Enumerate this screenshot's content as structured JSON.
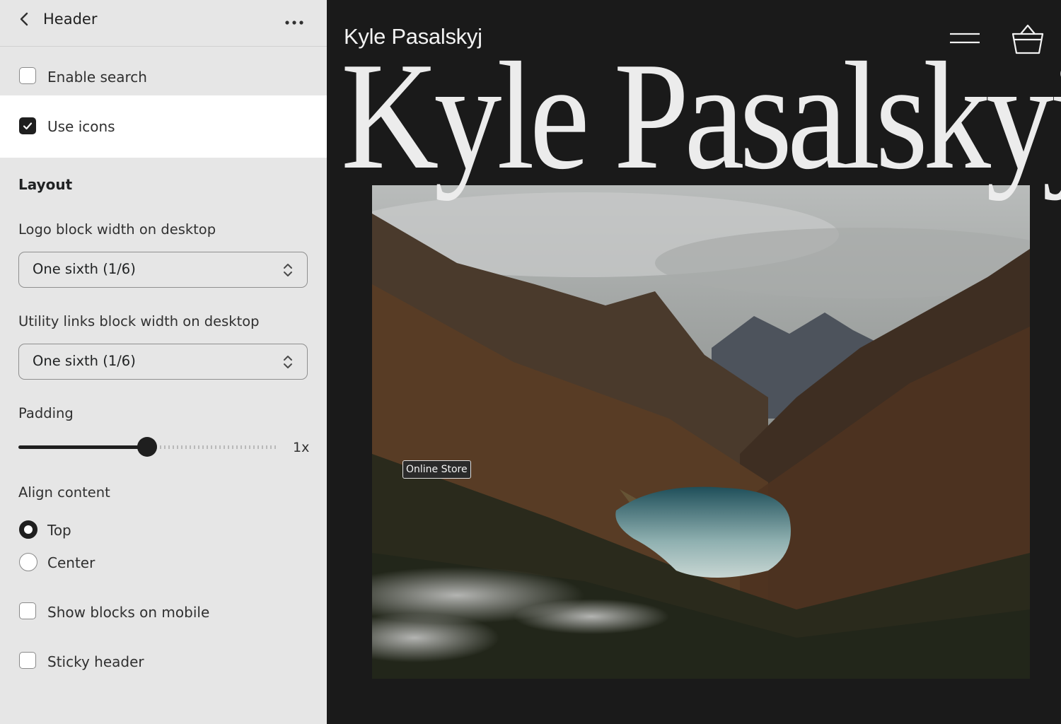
{
  "panel": {
    "title": "Header",
    "enable_search": {
      "label": "Enable search",
      "checked": false
    },
    "use_icons": {
      "label": "Use icons",
      "checked": true
    },
    "layout_title": "Layout",
    "logo_width": {
      "label": "Logo block width on desktop",
      "value": "One sixth (1/6)"
    },
    "utility_width": {
      "label": "Utility links block width on desktop",
      "value": "One sixth (1/6)"
    },
    "padding": {
      "label": "Padding",
      "value_text": "1x",
      "level": 0.5
    },
    "align": {
      "label": "Align content",
      "options": [
        "Top",
        "Center"
      ],
      "selected": "Top"
    },
    "show_blocks_mobile": {
      "label": "Show blocks on mobile",
      "checked": false
    },
    "sticky_header": {
      "label": "Sticky header",
      "checked": false
    }
  },
  "preview": {
    "brand_small": "Kyle Pasalskyj",
    "brand_big": "Kyle Pasalskyj",
    "tooltip": "Online Store",
    "background": "#1a1a1a",
    "text_color": "#ececec"
  },
  "icons": [
    "chevron-left-icon",
    "more-horizontal-icon",
    "checkmark-icon",
    "select-chevron-icon",
    "hamburger-menu-icon",
    "shopping-basket-icon"
  ]
}
